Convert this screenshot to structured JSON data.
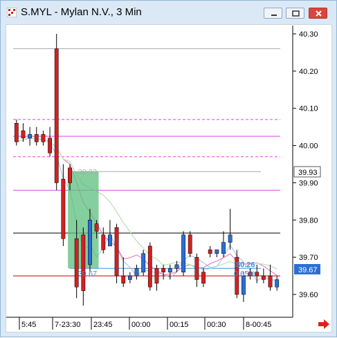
{
  "window": {
    "title": "S.MYL - Mylan N.V., 3 Min",
    "icon": "chart-app-icon",
    "buttons": [
      "minimize-icon",
      "restore-icon",
      "close-icon"
    ]
  },
  "chart": {
    "price_axis": [
      "40.30",
      "40.20",
      "40.10",
      "40.00",
      "39.90",
      "39.80",
      "39.70",
      "39.60"
    ],
    "last_price_tag": "39.93",
    "current_price_tag": "39.67",
    "time_axis": [
      "5:45",
      "7-23:30",
      "23:45",
      "00:00",
      "00:15",
      "00:30",
      "8-00:45"
    ],
    "annotations": {
      "box_top": "39.93",
      "box_bottom": "39.67",
      "change_abs": "$0.26",
      "change_pct": "0.65%"
    },
    "colors": {
      "up": "#2b6fd6",
      "down": "#d42020",
      "box_fill": "#5cbf7d",
      "measure_line": "#3b8fe0",
      "magenta": "#e040e0",
      "pink": "#f080c0",
      "red_line": "#c00000",
      "light_blue": "#a8c8e8",
      "light_green": "#b8e0b0"
    },
    "nav_arrow": "scroll-right-arrow-icon"
  },
  "chart_data": {
    "type": "candlestick",
    "ylim": [
      39.55,
      40.34
    ],
    "candles": [
      {
        "o": 40.06,
        "h": 40.07,
        "c": 40.01,
        "l": 40.0
      },
      {
        "o": 40.04,
        "h": 40.06,
        "c": 40.02,
        "l": 40.01
      },
      {
        "o": 40.02,
        "h": 40.05,
        "c": 40.03,
        "l": 40.0
      },
      {
        "o": 40.03,
        "h": 40.05,
        "c": 40.01,
        "l": 40.0
      },
      {
        "o": 40.03,
        "h": 40.04,
        "c": 40.01,
        "l": 40.0
      },
      {
        "o": 40.02,
        "h": 40.05,
        "c": 39.98,
        "l": 39.97
      },
      {
        "o": 40.26,
        "h": 40.3,
        "c": 39.9,
        "l": 39.88
      },
      {
        "o": 39.91,
        "h": 39.95,
        "c": 39.75,
        "l": 39.73
      },
      {
        "o": 39.94,
        "h": 39.95,
        "c": 39.9,
        "l": 39.88
      },
      {
        "o": 39.75,
        "h": 39.8,
        "c": 39.62,
        "l": 39.59
      },
      {
        "o": 39.76,
        "h": 39.78,
        "c": 39.61,
        "l": 39.57
      },
      {
        "o": 39.68,
        "h": 39.83,
        "c": 39.8,
        "l": 39.66
      },
      {
        "o": 39.79,
        "h": 39.8,
        "c": 39.77,
        "l": 39.75
      },
      {
        "o": 39.76,
        "h": 39.78,
        "c": 39.72,
        "l": 39.71
      },
      {
        "o": 39.73,
        "h": 39.8,
        "c": 39.76,
        "l": 39.73
      },
      {
        "o": 39.78,
        "h": 39.79,
        "c": 39.65,
        "l": 39.63
      },
      {
        "o": 39.65,
        "h": 39.7,
        "c": 39.63,
        "l": 39.62
      },
      {
        "o": 39.64,
        "h": 39.66,
        "c": 39.65,
        "l": 39.63
      },
      {
        "o": 39.65,
        "h": 39.68,
        "c": 39.67,
        "l": 39.64
      },
      {
        "o": 39.66,
        "h": 39.72,
        "c": 39.71,
        "l": 39.65
      },
      {
        "o": 39.73,
        "h": 39.74,
        "c": 39.62,
        "l": 39.61
      },
      {
        "o": 39.67,
        "h": 39.68,
        "c": 39.63,
        "l": 39.61
      },
      {
        "o": 39.67,
        "h": 39.68,
        "c": 39.66,
        "l": 39.64
      },
      {
        "o": 39.66,
        "h": 39.68,
        "c": 39.67,
        "l": 39.64
      },
      {
        "o": 39.67,
        "h": 39.69,
        "c": 39.68,
        "l": 39.66
      },
      {
        "o": 39.66,
        "h": 39.77,
        "c": 39.76,
        "l": 39.65
      },
      {
        "o": 39.76,
        "h": 39.77,
        "c": 39.71,
        "l": 39.7
      },
      {
        "o": 39.7,
        "h": 39.71,
        "c": 39.64,
        "l": 39.62
      },
      {
        "o": 39.66,
        "h": 39.67,
        "c": 39.63,
        "l": 39.62
      },
      {
        "o": 39.72,
        "h": 39.73,
        "c": 39.71,
        "l": 39.7
      },
      {
        "o": 39.71,
        "h": 39.72,
        "c": 39.72,
        "l": 39.7
      },
      {
        "o": 39.71,
        "h": 39.77,
        "c": 39.74,
        "l": 39.7
      },
      {
        "o": 39.74,
        "h": 39.83,
        "c": 39.76,
        "l": 39.72
      },
      {
        "o": 39.7,
        "h": 39.72,
        "c": 39.6,
        "l": 39.59
      },
      {
        "o": 39.6,
        "h": 39.66,
        "c": 39.65,
        "l": 39.58
      },
      {
        "o": 39.66,
        "h": 39.67,
        "c": 39.65,
        "l": 39.64
      },
      {
        "o": 39.66,
        "h": 39.68,
        "c": 39.65,
        "l": 39.63
      },
      {
        "o": 39.65,
        "h": 39.67,
        "c": 39.64,
        "l": 39.63
      },
      {
        "o": 39.65,
        "h": 39.68,
        "c": 39.62,
        "l": 39.61
      },
      {
        "o": 39.62,
        "h": 39.65,
        "c": 39.64,
        "l": 39.61
      }
    ],
    "hlines": [
      {
        "y": 40.26,
        "color": "#aaaaaa",
        "style": "solid"
      },
      {
        "y": 40.07,
        "color": "#e040e0",
        "style": "dashed"
      },
      {
        "y": 40.025,
        "color": "#e040e0",
        "style": "solid"
      },
      {
        "y": 39.97,
        "color": "#e040e0",
        "style": "dashed"
      },
      {
        "y": 39.88,
        "color": "#e040e0",
        "style": "solid"
      },
      {
        "y": 39.765,
        "color": "#000000",
        "style": "solid"
      },
      {
        "y": 39.65,
        "color": "#c00000",
        "style": "solid"
      }
    ]
  }
}
